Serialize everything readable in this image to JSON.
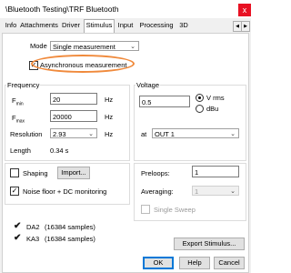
{
  "window": {
    "title": "\\Bluetooth Testing\\TRF Bluetooth",
    "close_glyph": "x"
  },
  "tabs": [
    {
      "label": "Info"
    },
    {
      "label": "Attachments"
    },
    {
      "label": "Driver"
    },
    {
      "label": "Stimulus",
      "active": true
    },
    {
      "label": "Input"
    },
    {
      "label": "Processing"
    },
    {
      "label": "3D"
    }
  ],
  "mode": {
    "label": "Mode",
    "value": "Single measurement"
  },
  "async": {
    "label": "Asynchronous measurement",
    "checked": true
  },
  "frequency": {
    "group_label": "Frequency",
    "fmin": {
      "label": "F",
      "sub": "min",
      "value": "20",
      "unit": "Hz"
    },
    "fmax": {
      "label": "F",
      "sub": "max",
      "value": "20000",
      "unit": "Hz"
    },
    "resolution": {
      "label": "Resolution",
      "value": "2.93",
      "unit": "Hz"
    },
    "length": {
      "label": "Length",
      "value": "0.34 s"
    }
  },
  "voltage": {
    "group_label": "Voltage",
    "value": "0.5",
    "unit_options": [
      {
        "label": "V rms",
        "selected": true
      },
      {
        "label": "dBu",
        "selected": false
      }
    ],
    "at_label": "at",
    "output": "OUT 1"
  },
  "shaping": {
    "label": "Shaping",
    "checked": false,
    "import_label": "Import..."
  },
  "noise": {
    "label": "Noise floor + DC  monitoring",
    "checked": true
  },
  "preloops": {
    "label": "Preloops:",
    "value": "1"
  },
  "averaging": {
    "label": "Averaging:",
    "value": "1"
  },
  "single_sweep": {
    "label": "Single Sweep",
    "checked": false
  },
  "samples": [
    {
      "name": "DA2",
      "detail": "(16384 samples)"
    },
    {
      "name": "KA3",
      "detail": "(16384 samples)"
    }
  ],
  "buttons": {
    "export": "Export Stimulus...",
    "ok": "OK",
    "help": "Help",
    "cancel": "Cancel"
  },
  "colors": {
    "highlight": "#f08a3c",
    "close": "#e81123"
  }
}
